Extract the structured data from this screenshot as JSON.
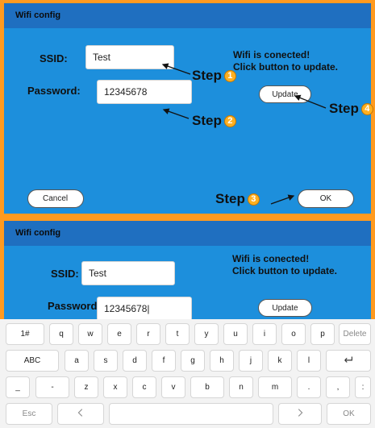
{
  "top_screen": {
    "title": "Wifi config",
    "ssid_label": "SSID:",
    "ssid_value": "Test",
    "password_label": "Password:",
    "password_value": "12345678",
    "status_line1": "Wifi is conected!",
    "status_line2": "Click button to update.",
    "update_label": "Update",
    "cancel_label": "Cancel",
    "ok_label": "OK"
  },
  "steps": [
    {
      "label": "Step",
      "num": "1"
    },
    {
      "label": "Step",
      "num": "2"
    },
    {
      "label": "Step",
      "num": "3"
    },
    {
      "label": "Step",
      "num": "4"
    }
  ],
  "bottom_screen": {
    "title": "Wifi config",
    "ssid_label": "SSID:",
    "ssid_value": "Test",
    "password_label": "Password:",
    "password_value": "12345678|",
    "status_line1": "Wifi is conected!",
    "status_line2": "Click button to update.",
    "update_label": "Update"
  },
  "keyboard": {
    "row1": [
      "1#",
      "q",
      "w",
      "e",
      "r",
      "t",
      "y",
      "u",
      "i",
      "o",
      "p",
      "Delete"
    ],
    "row2": [
      "ABC",
      "a",
      "s",
      "d",
      "f",
      "g",
      "h",
      "j",
      "k",
      "l"
    ],
    "row3": [
      "_",
      "-",
      "z",
      "x",
      "c",
      "v",
      "b",
      "n",
      "m",
      ".",
      ",",
      ":"
    ],
    "row4": {
      "esc": "Esc",
      "ok": "OK"
    },
    "icons": {
      "enter": "enter-icon",
      "left": "chevron-left-icon",
      "right": "chevron-right-icon"
    }
  },
  "colors": {
    "background": "#ff9a1f",
    "panel": "#1d8fdc",
    "titlebar": "#1f6fc0",
    "step_badge": "#ffb020"
  }
}
